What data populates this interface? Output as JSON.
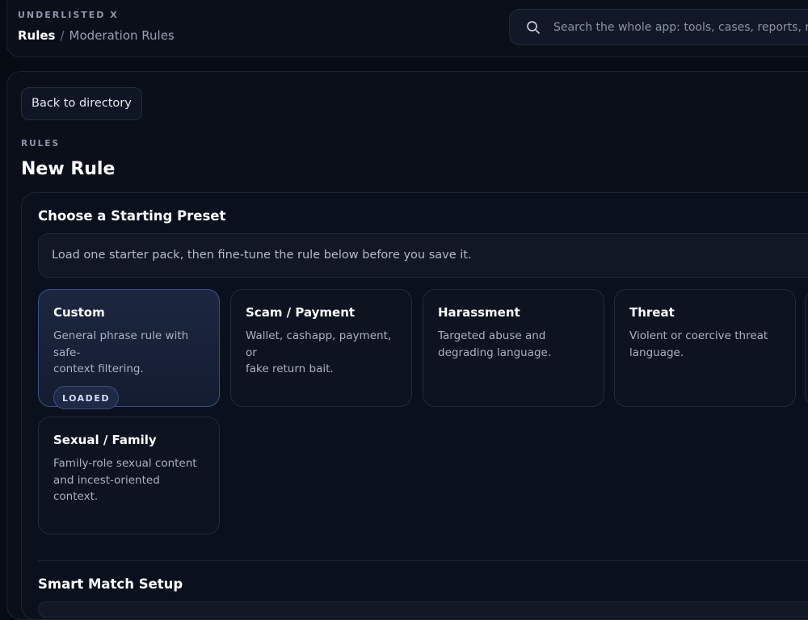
{
  "app": {
    "brand": "UNDERLISTED X"
  },
  "breadcrumb": {
    "current": "Rules",
    "separator": "/",
    "parent": "Moderation Rules"
  },
  "search": {
    "icon": "search-icon",
    "placeholder": "Search the whole app: tools, cases, reports, rules"
  },
  "back_button": {
    "label": "Back to directory"
  },
  "page": {
    "eyebrow": "RULES",
    "title": "New Rule"
  },
  "preset_panel": {
    "title": "Choose a Starting Preset",
    "hint": "Load one starter pack, then fine-tune the rule below before you save it.",
    "presets": [
      {
        "title": "Custom",
        "line1": "General phrase rule with safe-",
        "line2": "context filtering.",
        "badge": "LOADED",
        "selected": true
      },
      {
        "title": "Scam / Payment",
        "line1": "Wallet, cashapp, payment, or",
        "line2": "fake return bait.",
        "selected": false
      },
      {
        "title": "Harassment",
        "line1": "Targeted abuse and",
        "line2": "degrading language.",
        "selected": false
      },
      {
        "title": "Threat",
        "line1": "Violent or coercive threat",
        "line2": "language.",
        "selected": false
      },
      {
        "title": "Sexual / Family",
        "line1": "Family-role sexual content",
        "line2": "and incest-oriented context.",
        "selected": false
      }
    ]
  },
  "smart_match": {
    "title": "Smart Match Setup"
  },
  "colors": {
    "background": "#070b14",
    "surface": "#0b111c",
    "accent": "#3b4f88",
    "text": "#ffffff",
    "muted": "#aab2c1"
  }
}
